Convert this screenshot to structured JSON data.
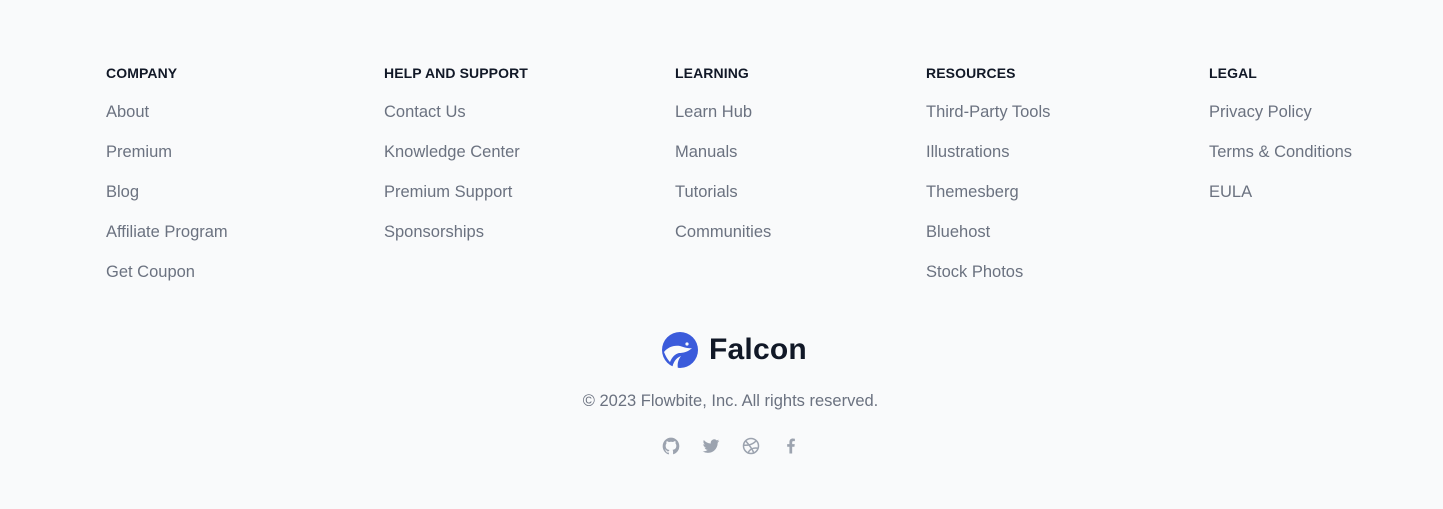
{
  "footer": {
    "columns": [
      {
        "heading": "COMPANY",
        "links": [
          "About",
          "Premium",
          "Blog",
          "Affiliate Program",
          "Get Coupon"
        ]
      },
      {
        "heading": "HELP AND SUPPORT",
        "links": [
          "Contact Us",
          "Knowledge Center",
          "Premium Support",
          "Sponsorships"
        ]
      },
      {
        "heading": "LEARNING",
        "links": [
          "Learn Hub",
          "Manuals",
          "Tutorials",
          "Communities"
        ]
      },
      {
        "heading": "RESOURCES",
        "links": [
          "Third-Party Tools",
          "Illustrations",
          "Themesberg",
          "Bluehost",
          "Stock Photos"
        ]
      },
      {
        "heading": "LEGAL",
        "links": [
          "Privacy Policy",
          "Terms & Conditions",
          "EULA"
        ]
      }
    ],
    "brand": {
      "name": "Falcon",
      "logo_icon": "falcon-logo-icon",
      "logo_color": "#3b5bdb"
    },
    "copyright": "© 2023 Flowbite, Inc. All rights reserved.",
    "social": [
      {
        "icon": "github-icon"
      },
      {
        "icon": "twitter-icon"
      },
      {
        "icon": "dribbble-icon"
      },
      {
        "icon": "facebook-icon"
      }
    ],
    "colors": {
      "background": "#f9fafb",
      "heading": "#111827",
      "link": "#6b7280",
      "social_icon": "#9ca3af"
    }
  }
}
